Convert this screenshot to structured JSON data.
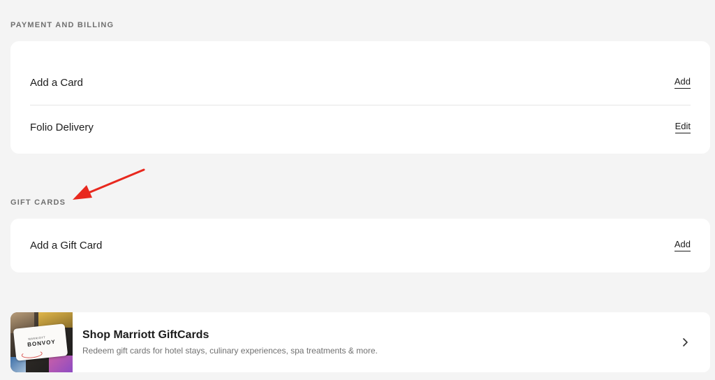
{
  "payment_section": {
    "heading": "PAYMENT AND BILLING",
    "rows": [
      {
        "label": "Add a Card",
        "action": "Add"
      },
      {
        "label": "Folio Delivery",
        "action": "Edit"
      }
    ]
  },
  "gift_section": {
    "heading": "GIFT CARDS",
    "rows": [
      {
        "label": "Add a Gift Card",
        "action": "Add"
      }
    ]
  },
  "promo": {
    "title": "Shop Marriott GiftCards",
    "subtitle": "Redeem gift cards for hotel stays, culinary experiences, spa treatments & more.",
    "thumb_brand_small": "MARRIOTT",
    "thumb_brand": "BONVOY",
    "chevron_icon": "chevron-right-icon"
  },
  "colors": {
    "background": "#f4f4f4",
    "card": "#ffffff",
    "heading": "#707070",
    "text": "#1c1c1c",
    "annotation_arrow": "#e8281e"
  }
}
